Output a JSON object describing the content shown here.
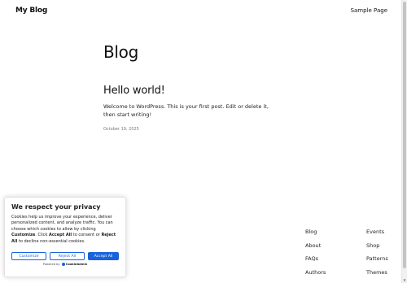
{
  "header": {
    "site_title": "My Blog",
    "nav_links": [
      "Sample Page"
    ]
  },
  "main": {
    "page_title": "Blog",
    "post": {
      "title": "Hello world!",
      "excerpt": "Welcome to WordPress. This is your first post. Edit or delete it, then start writing!",
      "date": "October 19, 2025"
    }
  },
  "footer": {
    "col1": [
      "Blog",
      "About",
      "FAQs",
      "Authors"
    ],
    "col2": [
      "Events",
      "Shop",
      "Patterns",
      "Themes"
    ]
  },
  "cookie_banner": {
    "title": "We respect your privacy",
    "text_intro": "Cookies help us improve your experience, deliver personalized content, and analyze traffic. You can choose which cookies to allow by clicking ",
    "customize_word": "Customize",
    "text_mid1": ". Click ",
    "accept_all_word": "Accept All",
    "text_mid2": " to consent or ",
    "reject_all_word": "Reject All",
    "text_end": " to decline non-essential cookies.",
    "buttons": {
      "customize": "Customize",
      "reject": "Reject All",
      "accept": "Accept All"
    },
    "powered_by": "Powered by",
    "brand": "CookieAdmin"
  },
  "colors": {
    "accent": "#1863dc"
  }
}
